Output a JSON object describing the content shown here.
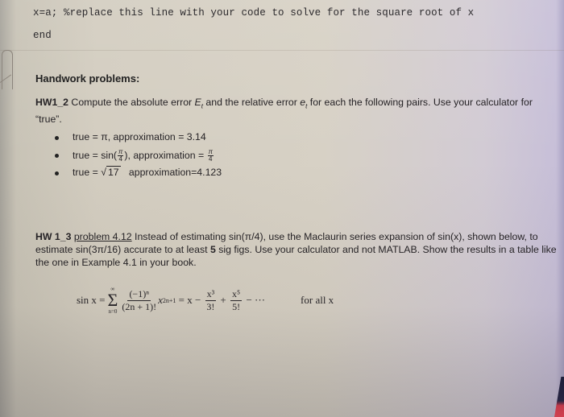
{
  "code": {
    "line1": "x=a; %replace this line with your code to solve for the square root of x",
    "line2": "end"
  },
  "heading": "Handwork problems:",
  "hw1_2": {
    "label": "HW1_2",
    "text_a": " Compute the absolute error ",
    "sym_abs": "E",
    "sym_abs_sub": "t",
    "text_b": " and the relative error ",
    "sym_rel": "e",
    "sym_rel_sub": "t",
    "text_c": " for each the following pairs. Use your calculator for “true”.",
    "pairs": [
      {
        "true_prefix": "true = π, ",
        "approx": "approximation = 3.14"
      },
      {
        "true_prefix": "true = sin(",
        "frac_num": "π",
        "frac_den": "4",
        "true_suffix": "), approximation = ",
        "approx_num": "π",
        "approx_den": "4"
      },
      {
        "true_prefix": "true = √",
        "radicand": "17",
        "approx": "   approximation=4.123"
      }
    ]
  },
  "hw1_3": {
    "label": "HW 1_3",
    "link": "problem 4.12",
    "text_a": " Instead of estimating sin(π/4), use the Maclaurin series expansion of sin(x), shown below, to estimate sin(3π/16) accurate to at least ",
    "bold_5": "5",
    "text_b": " sig figs. Use your calculator and not MATLAB. Show the results in a table like the one in Example 4.1 in your book."
  },
  "formula": {
    "lhs": "sin x =",
    "sum_top": "∞",
    "sum_symbol": "Σ",
    "sum_bottom": "n=0",
    "term_num": "(−1)ⁿ",
    "term_den": "(2n + 1)!",
    "term_x": "x",
    "term_exp": "2n+1",
    "eq": " = x − ",
    "t1_num": "x³",
    "t1_den": "3!",
    "plus": " + ",
    "t2_num": "x⁵",
    "t2_den": "5!",
    "tail": " − ···",
    "condition": "for all x"
  }
}
